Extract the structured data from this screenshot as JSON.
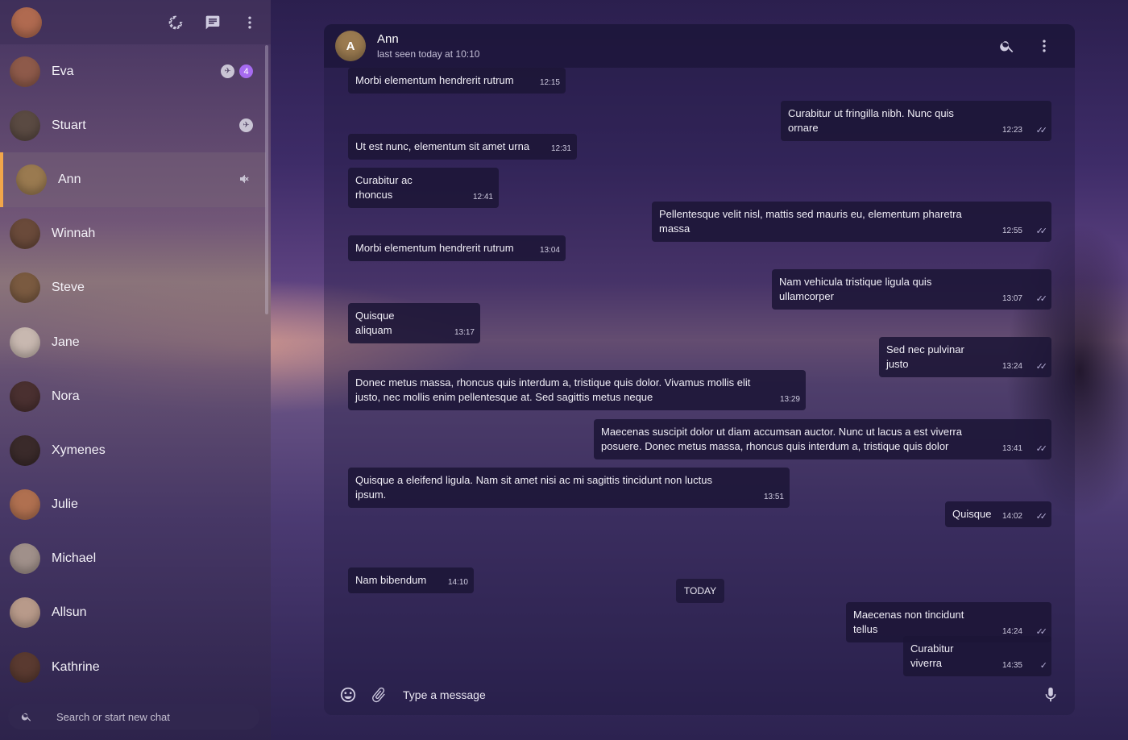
{
  "colors": {
    "accent": "#f1a64a",
    "unread_badge": "#a66bf0"
  },
  "self_avatar": {
    "initials": "",
    "color": "#b06a50"
  },
  "sidebar_icons": [
    "status-icon",
    "new-chat-icon",
    "menu-icon"
  ],
  "chats": [
    {
      "name": "Eva",
      "color": "#8e5a4a",
      "pinned": true,
      "unread": "4",
      "muted": false,
      "active": false
    },
    {
      "name": "Stuart",
      "color": "#5a4a42",
      "pinned": true,
      "unread": "",
      "muted": false,
      "active": false
    },
    {
      "name": "Ann",
      "color": "#9a7a50",
      "pinned": false,
      "unread": "",
      "muted": true,
      "active": true
    },
    {
      "name": "Winnah",
      "color": "#6a4a3a",
      "pinned": false,
      "unread": "",
      "muted": false,
      "active": false
    },
    {
      "name": "Steve",
      "color": "#7a5a40",
      "pinned": false,
      "unread": "",
      "muted": false,
      "active": false
    },
    {
      "name": "Jane",
      "color": "#c8b8b0",
      "pinned": false,
      "unread": "",
      "muted": false,
      "active": false
    },
    {
      "name": "Nora",
      "color": "#4a3030",
      "pinned": false,
      "unread": "",
      "muted": false,
      "active": false
    },
    {
      "name": "Xymenes",
      "color": "#3a2a2a",
      "pinned": false,
      "unread": "",
      "muted": false,
      "active": false
    },
    {
      "name": "Julie",
      "color": "#b07050",
      "pinned": false,
      "unread": "",
      "muted": false,
      "active": false
    },
    {
      "name": "Michael",
      "color": "#a0908a",
      "pinned": false,
      "unread": "",
      "muted": false,
      "active": false
    },
    {
      "name": "Allsun",
      "color": "#b89a8a",
      "pinned": false,
      "unread": "",
      "muted": false,
      "active": false
    },
    {
      "name": "Kathrine",
      "color": "#5a3a30",
      "pinned": false,
      "unread": "",
      "muted": false,
      "active": false
    }
  ],
  "search": {
    "placeholder": "Search or start new chat"
  },
  "conversation": {
    "name": "Ann",
    "status": "last seen today at 10:10",
    "avatar_color": "#9a7a50",
    "day_separator": "TODAY",
    "messages": [
      {
        "dir": "in",
        "text": "Morbi elementum hendrerit rutrum",
        "time": "12:15"
      },
      {
        "dir": "out",
        "text": "Curabitur ut fringilla nibh. Nunc quis ornare",
        "time": "12:23",
        "status": "read"
      },
      {
        "dir": "in",
        "text": "Ut est nunc, elementum sit amet urna",
        "time": "12:31"
      },
      {
        "dir": "in",
        "text": "Curabitur ac rhoncus",
        "time": "12:41"
      },
      {
        "dir": "out",
        "text": "Pellentesque velit nisl, mattis sed mauris eu, elementum pharetra massa",
        "time": "12:55",
        "status": "read"
      },
      {
        "dir": "in",
        "text": "Morbi elementum hendrerit rutrum",
        "time": "13:04"
      },
      {
        "dir": "out",
        "text": "Nam vehicula tristique ligula quis ullamcorper",
        "time": "13:07",
        "status": "read"
      },
      {
        "dir": "in",
        "text": "Quisque aliquam",
        "time": "13:17"
      },
      {
        "dir": "out",
        "text": "Sed nec pulvinar justo",
        "time": "13:24",
        "status": "read"
      },
      {
        "dir": "in",
        "text": "Donec metus massa, rhoncus quis interdum a, tristique quis dolor. Vivamus mollis elit justo, nec mollis enim pellentesque at. Sed sagittis metus neque",
        "time": "13:29"
      },
      {
        "dir": "out",
        "text": "Maecenas suscipit dolor ut diam accumsan auctor. Nunc ut lacus a est viverra posuere. Donec metus massa, rhoncus quis interdum a, tristique quis dolor",
        "time": "13:41",
        "status": "read"
      },
      {
        "dir": "in",
        "text": "Quisque a eleifend ligula. Nam sit amet nisi ac mi sagittis tincidunt non luctus ipsum.",
        "time": "13:51"
      },
      {
        "dir": "out",
        "text": "Quisque",
        "time": "14:02",
        "status": "read"
      },
      {
        "dir": "in",
        "text": "Nam bibendum",
        "time": "14:10"
      },
      {
        "dir": "out",
        "text": "Maecenas non tincidunt tellus",
        "time": "14:24",
        "status": "read"
      },
      {
        "dir": "out",
        "text": "Curabitur viverra",
        "time": "14:35",
        "status": "sent"
      }
    ]
  },
  "composer": {
    "placeholder": "Type a message"
  }
}
